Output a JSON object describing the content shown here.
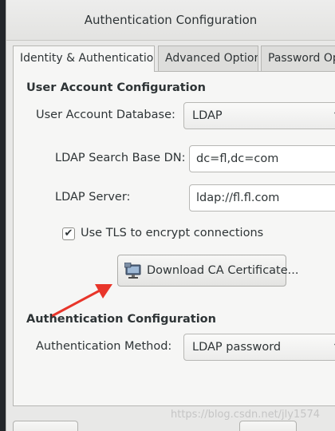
{
  "window": {
    "title": "Authentication Configuration"
  },
  "tabs": [
    {
      "label": "Identity & Authentication",
      "active": true
    },
    {
      "label": "Advanced Options",
      "active": false
    },
    {
      "label": "Password Opti",
      "active": false
    }
  ],
  "user_account": {
    "heading": "User Account Configuration",
    "database_label": "User Account Database:",
    "database_value": "LDAP",
    "base_dn_label": "LDAP Search Base DN:",
    "base_dn_value": "dc=fl,dc=com",
    "server_label": "LDAP Server:",
    "server_value": "ldap://fl.fl.com",
    "tls_label": "Use TLS to encrypt connections",
    "tls_checked": true,
    "tls_check_glyph": "✔",
    "download_label": "Download CA Certificate...",
    "download_icon": "network-computer-icon"
  },
  "authentication": {
    "heading": "Authentication Configuration",
    "method_label": "Authentication Method:",
    "method_value": "LDAP password"
  },
  "icons": {
    "dropdown_glyph": "▼"
  },
  "annotation": {
    "arrow_color": "#e8352a"
  },
  "watermark": "https://blog.csdn.net/jly1574"
}
